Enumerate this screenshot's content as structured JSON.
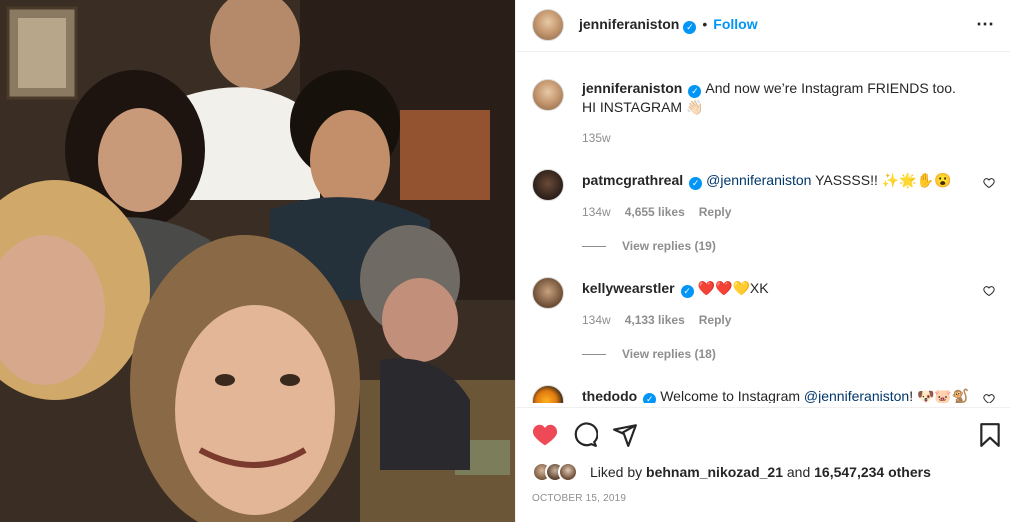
{
  "header": {
    "username": "jenniferaniston",
    "separator": "•",
    "follow_label": "Follow",
    "more_icon": "more-horizontal-icon"
  },
  "caption": {
    "username": "jenniferaniston",
    "text": "And now we’re Instagram FRIENDS too. HI INSTAGRAM 👋🏻",
    "time": "135w"
  },
  "comments": [
    {
      "username": "patmcgrathreal",
      "mention": "@jenniferaniston",
      "text": " YASSSS!! ✨🌟✋😮",
      "time": "134w",
      "likes": "4,655 likes",
      "reply_label": "Reply",
      "view_replies": "View replies (19)"
    },
    {
      "username": "kellywearstler",
      "mention": "",
      "text": "❤️❤️💛XK",
      "time": "134w",
      "likes": "4,133 likes",
      "reply_label": "Reply",
      "view_replies": "View replies (18)"
    },
    {
      "username": "thedodo",
      "mention": "@jenniferaniston",
      "text_before": "Welcome to Instagram ",
      "text_after": "! 🐶🐷🐒🦀"
    }
  ],
  "likes": {
    "prefix": "Liked by ",
    "first_user": "behnam_nikozad_21",
    "middle": " and ",
    "count": "16,547,234 others"
  },
  "date": "OCTOBER 15, 2019",
  "colors": {
    "accent": "#0095f6",
    "like_red": "#ed4956",
    "muted": "#8e8e8e",
    "mention": "#00376b"
  }
}
